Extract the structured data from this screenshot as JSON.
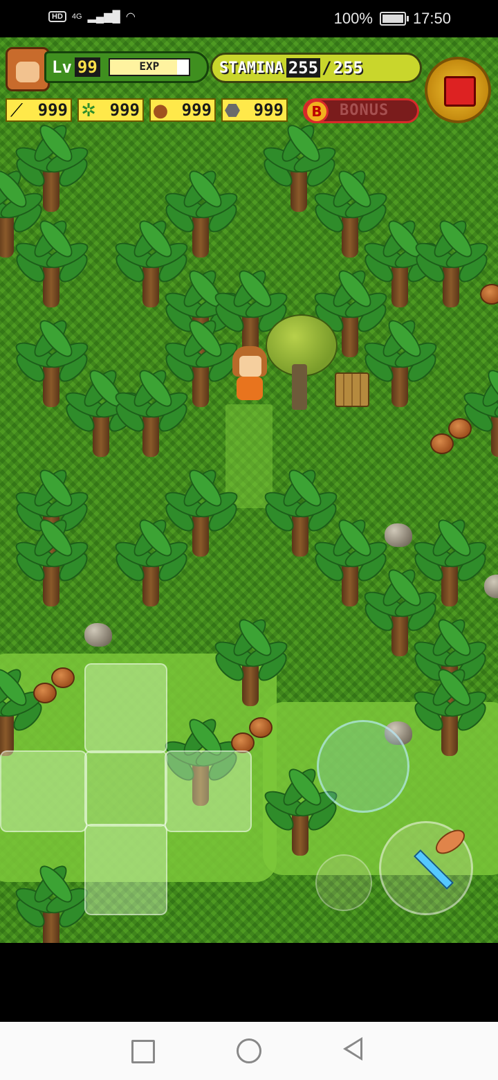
{
  "status_bar": {
    "hd_badge": "HD",
    "network": "4G",
    "battery": "100%",
    "time": "17:50"
  },
  "hud": {
    "level_label": "Lv",
    "level_value": "99",
    "exp_label": "EXP",
    "exp_fill": 0.85,
    "stamina_label": "STAMINA",
    "stamina_current": "255",
    "stamina_separator": "/",
    "stamina_max": "255",
    "resources": [
      {
        "icon": "twig-icon",
        "value": "999"
      },
      {
        "icon": "leaf-branch-icon",
        "value": "999"
      },
      {
        "icon": "nut-icon",
        "value": "999"
      },
      {
        "icon": "stone-icon",
        "value": "999"
      }
    ],
    "bonus_badge": "B",
    "bonus_label": "BONUS"
  },
  "controls": {
    "dpad": "dpad",
    "action_button": "action-button",
    "tool_button": "tool-button",
    "item_button": "item-button",
    "shop_button": "treasure-chest-icon"
  },
  "colors": {
    "grass": "#4e9a22",
    "hud_green": "#3f8f1f",
    "stamina_yellow": "#c9d62c",
    "resource_yellow": "#ffe94a",
    "bonus_red": "#d82a2a"
  }
}
